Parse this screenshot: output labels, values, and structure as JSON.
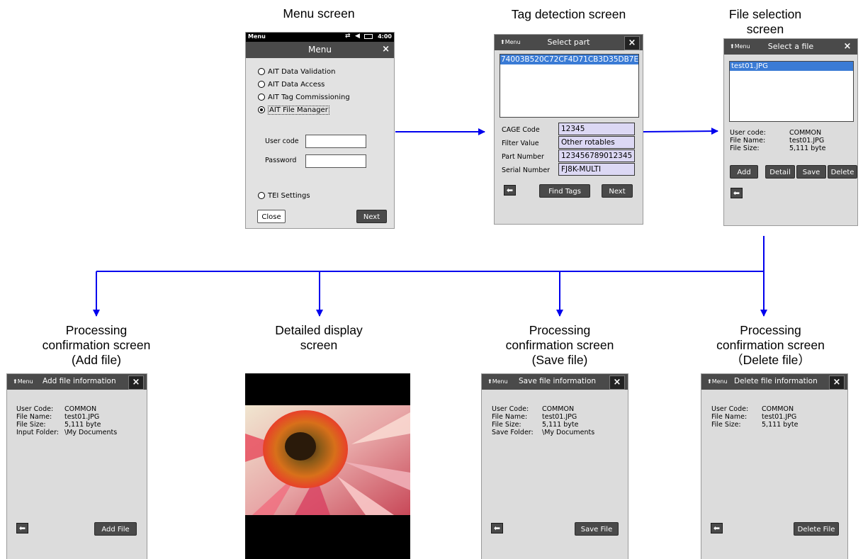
{
  "captions": {
    "menu": "Menu screen",
    "tag": "Tag detection screen",
    "file_sel_1": "File selection",
    "file_sel_2": "screen",
    "add_1": "Processing",
    "add_2": "confirmation screen",
    "add_3": "(Add file)",
    "detail_1": "Detailed display",
    "detail_2": "screen",
    "save_1": "Processing",
    "save_2": "confirmation screen",
    "save_3": "(Save file)",
    "delete_1": "Processing",
    "delete_2": "confirmation screen",
    "delete_3": "（Delete file）"
  },
  "menu_screen": {
    "status_left": "Menu",
    "status_time": "4:00",
    "title": "Menu",
    "close_x": "×",
    "options": [
      "AIT Data Validation",
      "AIT Data Access",
      "AIT Tag Commissioning",
      "AIT File Manager"
    ],
    "selected_index": 3,
    "user_code_label": "User code",
    "password_label": "Password",
    "tei_label": "TEI Settings",
    "close_button": "Close",
    "next_button": "Next"
  },
  "tag_screen": {
    "menu_link": "⬆Menu",
    "title": "Select part",
    "close_x": "×",
    "tag_id": "74003B520C72CF4D71CB3D35DB7E",
    "fields": [
      {
        "label": "CAGE Code",
        "value": "12345"
      },
      {
        "label": "Filter Value",
        "value": "Other rotables"
      },
      {
        "label": "Part Number",
        "value": "123456789012345"
      },
      {
        "label": "Serial Number",
        "value": "FJ8K-MULTI"
      }
    ],
    "back": "⬅",
    "find_tags": "Find Tags",
    "next": "Next"
  },
  "file_screen": {
    "menu_link": "⬆Menu",
    "title": "Select a file",
    "close_x": "×",
    "file": "test01.JPG",
    "info": [
      {
        "label": "User code:",
        "value": "COMMON"
      },
      {
        "label": "File Name:",
        "value": "test01.JPG"
      },
      {
        "label": "File Size:",
        "value": "5,111 byte"
      }
    ],
    "add": "Add",
    "detail": "Detail",
    "save": "Save",
    "delete": "Delete",
    "back": "⬅"
  },
  "add_screen": {
    "menu_link": "⬆Menu",
    "title": "Add file information",
    "close_x": "×",
    "info": [
      {
        "label": "User Code:",
        "value": "COMMON"
      },
      {
        "label": "File Name:",
        "value": "test01.JPG"
      },
      {
        "label": "File Size:",
        "value": "5,111 byte"
      },
      {
        "label": "Input Folder:",
        "value": "\\My Documents"
      }
    ],
    "back": "⬅",
    "action": "Add File"
  },
  "save_screen": {
    "menu_link": "⬆Menu",
    "title": "Save file information",
    "close_x": "×",
    "info": [
      {
        "label": "User Code:",
        "value": "COMMON"
      },
      {
        "label": "File Name:",
        "value": "test01.JPG"
      },
      {
        "label": "File Size:",
        "value": "5,111 byte"
      },
      {
        "label": "Save Folder:",
        "value": "\\My Documents"
      }
    ],
    "back": "⬅",
    "action": "Save File"
  },
  "delete_screen": {
    "menu_link": "⬆Menu",
    "title": "Delete file information",
    "close_x": "×",
    "info": [
      {
        "label": "User Code:",
        "value": "COMMON"
      },
      {
        "label": "File Name:",
        "value": "test01.JPG"
      },
      {
        "label": "File Size:",
        "value": "5,111 byte"
      }
    ],
    "back": "⬅",
    "action": "Delete File"
  },
  "colors": {
    "arrow": "#0000ee",
    "titlebar": "#4a4a4a",
    "phone_bg": "#dcdcdc",
    "field_bg": "#dcd8f4",
    "selection": "#3a7bd5"
  }
}
